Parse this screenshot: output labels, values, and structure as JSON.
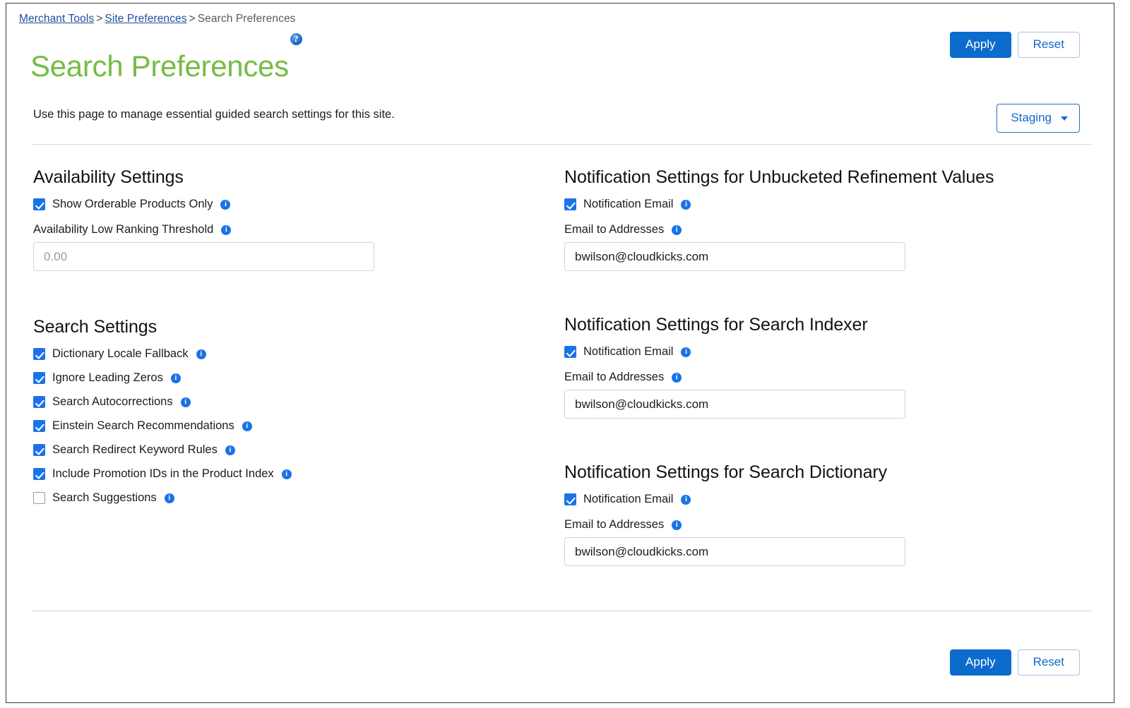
{
  "breadcrumb": {
    "item1": "Merchant Tools",
    "sep1": ">",
    "item2": "Site Preferences",
    "sep2": ">",
    "current": "Search Preferences"
  },
  "header": {
    "title": "Search Preferences",
    "help_icon": "help-circle-icon",
    "apply_label": "Apply",
    "reset_label": "Reset"
  },
  "intro": {
    "description": "Use this page to manage essential guided search settings for this site.",
    "environment_selected": "Staging"
  },
  "availability": {
    "section_title": "Availability Settings",
    "show_orderable": {
      "label": "Show Orderable Products Only",
      "checked": true,
      "info_icon": "info-icon"
    },
    "threshold": {
      "label": "Availability Low Ranking Threshold",
      "info_icon": "info-icon",
      "value": "",
      "placeholder": "0.00"
    }
  },
  "search_settings": {
    "section_title": "Search Settings",
    "items": [
      {
        "label": "Dictionary Locale Fallback",
        "checked": true,
        "info_icon": "info-icon"
      },
      {
        "label": "Ignore Leading Zeros",
        "checked": true,
        "info_icon": "info-icon"
      },
      {
        "label": "Search Autocorrections",
        "checked": true,
        "info_icon": "info-icon"
      },
      {
        "label": "Einstein Search Recommendations",
        "checked": true,
        "info_icon": "info-icon"
      },
      {
        "label": "Search Redirect Keyword Rules",
        "checked": true,
        "info_icon": "info-icon"
      },
      {
        "label": "Include Promotion IDs in the Product Index",
        "checked": true,
        "info_icon": "info-icon"
      },
      {
        "label": "Search Suggestions",
        "checked": false,
        "info_icon": "info-icon"
      }
    ]
  },
  "notifications_unbucketed": {
    "section_title": "Notification Settings for Unbucketed Refinement Values",
    "notification_email_label": "Notification Email",
    "notification_email_checked": true,
    "email_addresses_label": "Email to Addresses",
    "email_addresses_value": "bwilson@cloudkicks.com"
  },
  "notifications_indexer": {
    "section_title": "Notification Settings for Search Indexer",
    "notification_email_label": "Notification Email",
    "notification_email_checked": true,
    "email_addresses_label": "Email to Addresses",
    "email_addresses_value": "bwilson@cloudkicks.com"
  },
  "notifications_dictionary": {
    "section_title": "Notification Settings for Search Dictionary",
    "notification_email_label": "Notification Email",
    "notification_email_checked": true,
    "email_addresses_label": "Email to Addresses",
    "email_addresses_value": "bwilson@cloudkicks.com"
  },
  "footer": {
    "apply_label": "Apply",
    "reset_label": "Reset"
  },
  "colors": {
    "title_green": "#76bc43",
    "primary_blue": "#0b6ccd",
    "link_blue": "#1f4f9c",
    "checkbox_blue": "#1a73e8"
  }
}
